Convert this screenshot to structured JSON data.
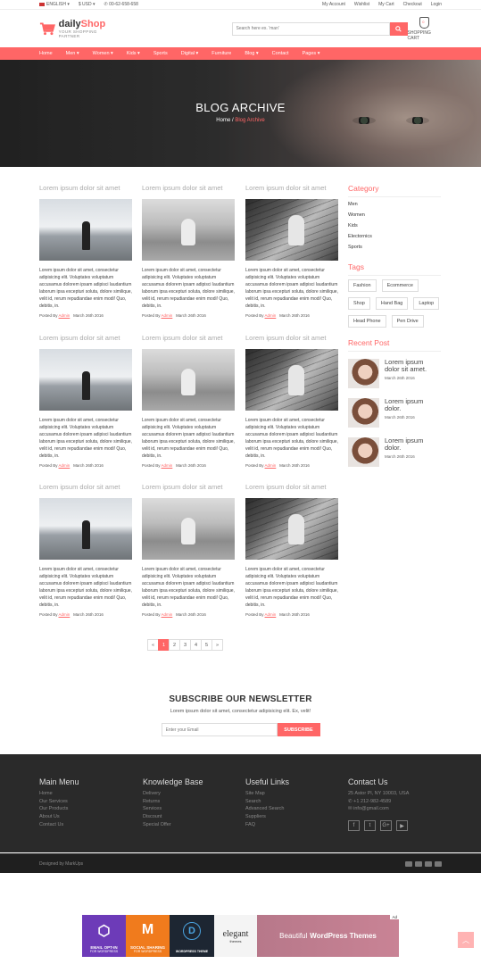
{
  "topbar": {
    "language": "ENGLISH",
    "currency": "$ USD",
    "phone": "00-62-658-658",
    "links": [
      "My Account",
      "Wishlist",
      "My Cart",
      "Checkout",
      "Login"
    ]
  },
  "header": {
    "logo_prefix": "daily",
    "logo_suffix": "Shop",
    "tagline": "YOUR SHOPPING PARTNER",
    "search_placeholder": "Search here ex. 'man'",
    "cart_label": "SHOPPING CART",
    "cart_count": "0"
  },
  "nav": [
    "Home",
    "Men ▾",
    "Women ▾",
    "Kids ▾",
    "Sports",
    "Digital ▾",
    "Furniture",
    "Blog ▾",
    "Contact",
    "Pages ▾"
  ],
  "hero": {
    "title": "BLOG ARCHIVE",
    "crumb_home": "Home",
    "crumb_sep": "/",
    "crumb_current": "Blog Archive"
  },
  "posts": {
    "title": "Lorem ipsum dolor sit amet",
    "excerpt": "Lorem ipsum dolor sit amet, consectetur adipisicing elit. Voluptates voluptatum accusamus dolorem ipsam adipisci laudantium laborum ipsa excepturi soluta, dolore similique, velit id, rerum repudiandae enim modi! Quo, debitis, in.",
    "posted_by": "Posted By",
    "author": "Admin",
    "date": "March 26th 2016"
  },
  "pagination": [
    "«",
    "1",
    "2",
    "3",
    "4",
    "5",
    "»"
  ],
  "sidebar": {
    "category_heading": "Category",
    "categories": [
      "Men",
      "Women",
      "Kids",
      "Electornics",
      "Sports"
    ],
    "tags_heading": "Tags",
    "tags": [
      "Fashion",
      "Ecommerce",
      "Shop",
      "Hand Bag",
      "Laptop",
      "Head Phone",
      "Pen Drive"
    ],
    "recent_heading": "Recent Post",
    "recent": [
      {
        "title": "Lorem ipsum dolor sit amet.",
        "date": "March 26th 2016"
      },
      {
        "title": "Lorem ipsum dolor.",
        "date": "March 26th 2016"
      },
      {
        "title": "Lorem ipsum dolor.",
        "date": "March 26th 2016"
      }
    ]
  },
  "newsletter": {
    "heading": "SUBSCRIBE OUR NEWSLETTER",
    "sub": "Lorem ipsum dolor sit amet, consectetur adipisicing elit. Ex, velit!",
    "placeholder": "Enter your Email",
    "button": "SUBSCRIBE"
  },
  "footer": {
    "col1": {
      "heading": "Main Menu",
      "links": [
        "Home",
        "Our Services",
        "Our Products",
        "About Us",
        "Contact Us"
      ]
    },
    "col2": {
      "heading": "Knowledge Base",
      "links": [
        "Delivery",
        "Returns",
        "Services",
        "Discount",
        "Special Offer"
      ]
    },
    "col3": {
      "heading": "Useful Links",
      "links": [
        "Site Map",
        "Search",
        "Advanced Search",
        "Suppliers",
        "FAQ"
      ]
    },
    "col4": {
      "heading": "Contact Us",
      "address": "25 Astor Pl, NY 10003, USA",
      "phone": "+1 212-982-4589",
      "email": "info@gmail.com"
    },
    "credit": "Designed by MarkUps"
  },
  "ad": {
    "tag": "Ad",
    "tile1": "EMAIL OPT-IN",
    "tile1_sub": "FOR WORDPRESS",
    "tile2": "SOCIAL SHARING",
    "tile2_sub": "FOR WORDPRESS",
    "tile3": "WORDPRESS THEME",
    "tile4": "elegant",
    "tile4_sub": "themes",
    "banner_pre": "Beautiful",
    "banner_bold": "WordPress Themes"
  },
  "colors": {
    "accent": "#ff6666",
    "footer_bg": "#2a2a2a"
  }
}
